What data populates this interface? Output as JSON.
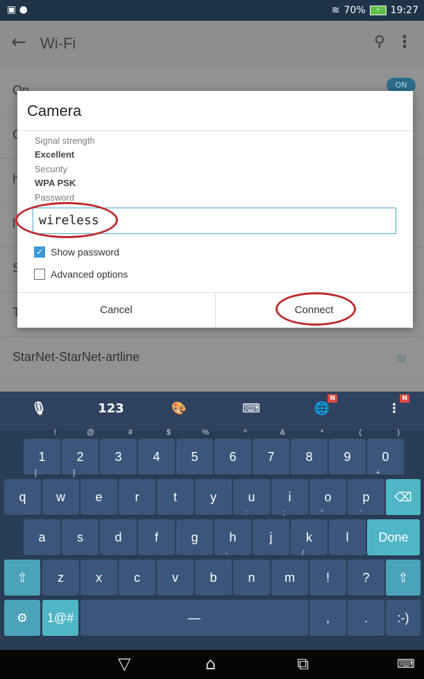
{
  "status_bar": {
    "time": "19:27",
    "battery": "70%"
  },
  "app_bar": {
    "title": "Wi-Fi"
  },
  "background_list": {
    "rows": [
      {
        "label": "On",
        "toggle": "ON"
      },
      {
        "label": "C"
      },
      {
        "label": "h"
      },
      {
        "label": "l"
      },
      {
        "label": "S"
      },
      {
        "label": "T"
      },
      {
        "label": "StarNet-StarNet-artline"
      }
    ]
  },
  "dialog": {
    "title": "Camera",
    "signal_label": "Signal strength",
    "signal_value": "Excellent",
    "security_label": "Security",
    "security_value": "WPA PSK",
    "password_label": "Password",
    "password_value": "wireless",
    "show_password": "Show password",
    "advanced_options": "Advanced options",
    "cancel": "Cancel",
    "connect": "Connect"
  },
  "keyboard": {
    "top_row": {
      "numbers": "123"
    },
    "row_numbers": [
      {
        "k": "1",
        "s": "!"
      },
      {
        "k": "2",
        "s": "@"
      },
      {
        "k": "3",
        "s": "#"
      },
      {
        "k": "4",
        "s": "$"
      },
      {
        "k": "5",
        "s": "%"
      },
      {
        "k": "6",
        "s": "^"
      },
      {
        "k": "7",
        "s": "&"
      },
      {
        "k": "8",
        "s": "*"
      },
      {
        "k": "9",
        "s": "("
      },
      {
        "k": "0",
        "s": ")"
      }
    ],
    "row_q": [
      {
        "k": "q",
        "s": "["
      },
      {
        "k": "w",
        "s": "]"
      },
      {
        "k": "e",
        "s": ""
      },
      {
        "k": "r",
        "s": ""
      },
      {
        "k": "t",
        "s": ""
      },
      {
        "k": "y",
        "s": ""
      },
      {
        "k": "u",
        "s": ""
      },
      {
        "k": "i",
        "s": ""
      },
      {
        "k": "o",
        "s": ""
      },
      {
        "k": "p",
        "s": "+"
      }
    ],
    "row_a": [
      {
        "k": "a",
        "s": ""
      },
      {
        "k": "s",
        "s": ""
      },
      {
        "k": "d",
        "s": ""
      },
      {
        "k": "f",
        "s": ""
      },
      {
        "k": "g",
        "s": ""
      },
      {
        "k": "h",
        "s": ":"
      },
      {
        "k": "j",
        "s": ";"
      },
      {
        "k": "k",
        "s": "\""
      },
      {
        "k": "l",
        "s": "'"
      }
    ],
    "row_z": [
      {
        "k": "z",
        "s": ""
      },
      {
        "k": "x",
        "s": ""
      },
      {
        "k": "c",
        "s": ""
      },
      {
        "k": "v",
        "s": ""
      },
      {
        "k": "b",
        "s": "-"
      },
      {
        "k": "n",
        "s": ""
      },
      {
        "k": "m",
        "s": "/"
      },
      {
        "k": "!",
        "s": ""
      },
      {
        "k": "?",
        "s": ""
      }
    ],
    "done": "Done",
    "symbols": "1@#",
    "comma": ",",
    "period": ".",
    "smiley": ":-)",
    "badge": "N"
  }
}
